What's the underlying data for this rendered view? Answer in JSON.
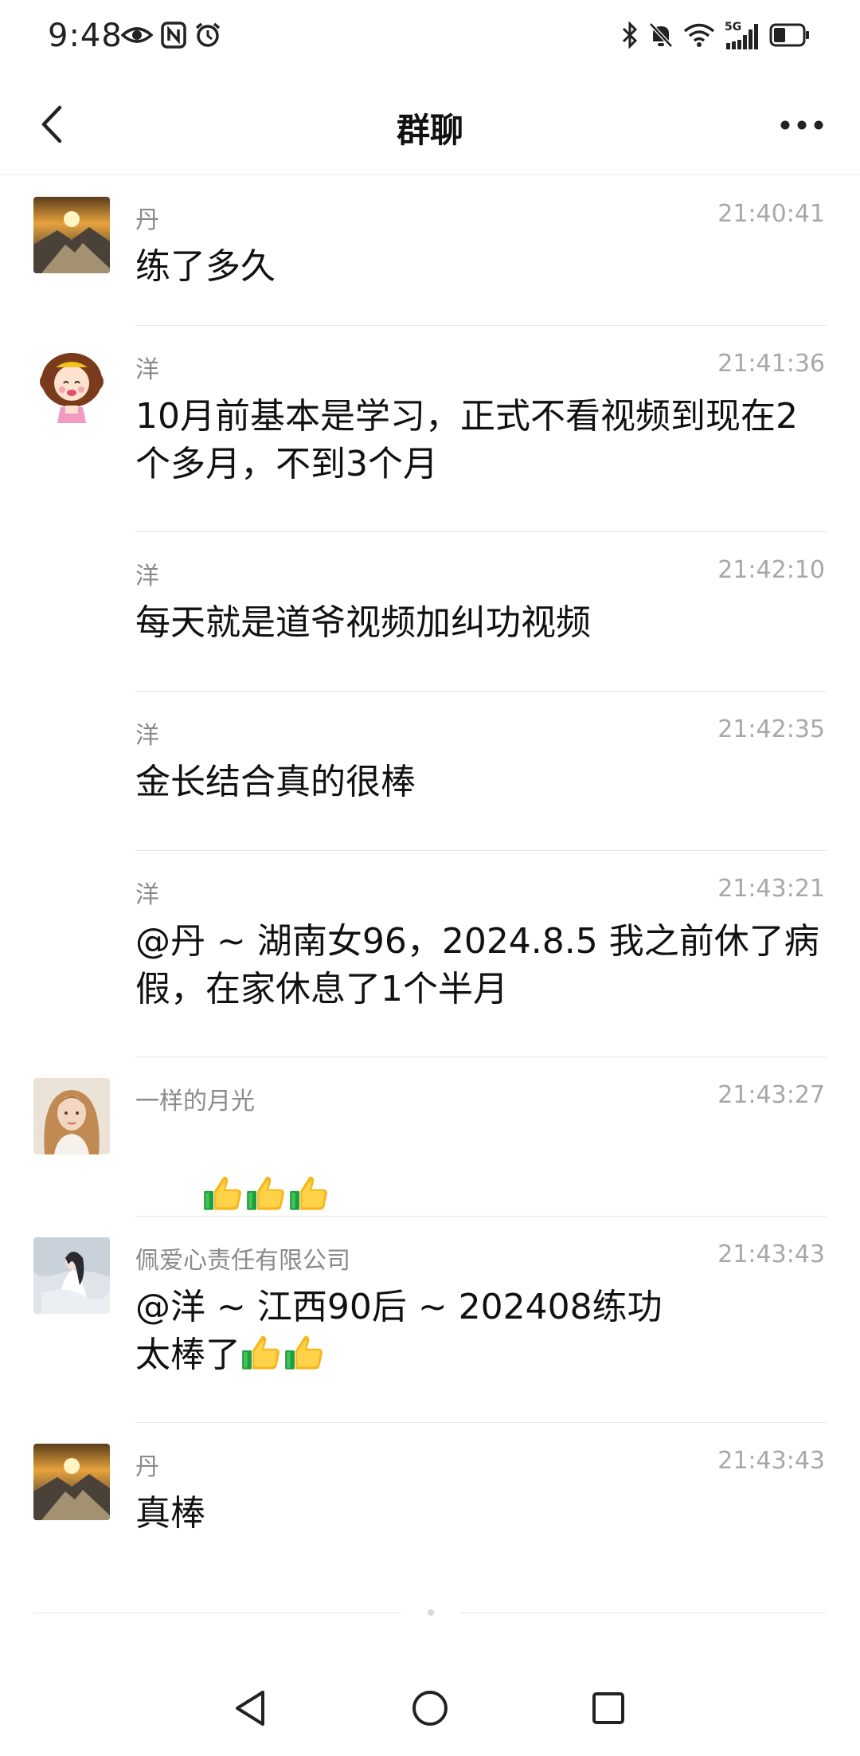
{
  "status_bar": {
    "time": "9:48",
    "left_icons": [
      "eye-icon",
      "nfc-icon",
      "alarm-icon"
    ],
    "right_icons": [
      "bluetooth-icon",
      "mute-bell-icon",
      "wifi-icon",
      "signal-5g-icon",
      "battery-icon"
    ],
    "network_label": "5G",
    "battery_level": 0.35
  },
  "nav": {
    "title": "群聊",
    "back_icon": "chevron-left-icon",
    "more_icon": "more-dots-icon"
  },
  "messages": [
    {
      "name": "丹",
      "time": "21:40:41",
      "text": "练了多久",
      "avatar": "sunset-mountain"
    },
    {
      "name": "洋",
      "time": "21:41:36",
      "text": "10月前基本是学习，正式不看视频到现在2\n个多月，不到3个月",
      "avatar": "cartoon-girl"
    },
    {
      "name": "洋",
      "time": "21:42:10",
      "text": "每天就是道爷视频加纠功视频",
      "avatar": ""
    },
    {
      "name": "洋",
      "time": "21:42:35",
      "text": "金长结合真的很棒",
      "avatar": ""
    },
    {
      "name": "洋",
      "time": "21:43:21",
      "text": "@丹 ~ 湖南女96，2024.8.5 我之前休了病\n假，在家休息了1个半月",
      "avatar": ""
    },
    {
      "name": "一样的月光",
      "time": "21:43:27",
      "text": "",
      "emoji": [
        "thumbs-up",
        "thumbs-up",
        "thumbs-up"
      ],
      "avatar": "long-hair-woman"
    },
    {
      "name": "佩爱心责任有限公司",
      "time": "21:43:43",
      "text": "@洋 ~ 江西90后 ~ 202408练功\n太棒了",
      "emoji": [
        "thumbs-up",
        "thumbs-up"
      ],
      "avatar": "white-dress-figure"
    },
    {
      "name": "丹",
      "time": "21:43:43",
      "text": "真棒",
      "avatar": "sunset-mountain"
    }
  ],
  "system_nav": {
    "back_icon": "triangle-back-icon",
    "home_icon": "circle-home-icon",
    "recents_icon": "square-recents-icon"
  },
  "colors": {
    "background": "#ffffff",
    "meta_text": "#8a8a8a",
    "time_text": "#a8a8a8",
    "divider": "#e6e6e6"
  }
}
